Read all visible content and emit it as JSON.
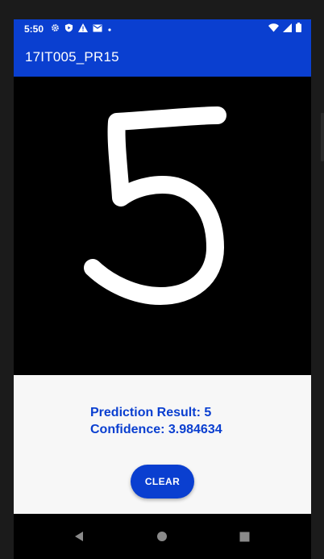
{
  "status_bar": {
    "time": "5:50",
    "left_icons": [
      "gear-icon",
      "play-protect-icon",
      "warning-icon",
      "mail-icon",
      "dot-icon"
    ],
    "right_icons": [
      "wifi-icon",
      "signal-icon",
      "battery-icon"
    ]
  },
  "app_bar": {
    "title": "17IT005_PR15",
    "color": "#0a3fd0"
  },
  "canvas": {
    "background": "#000000",
    "stroke_color": "#ffffff",
    "drawn_digit": "5"
  },
  "result": {
    "prediction_line": "Prediction Result: 5",
    "confidence_line": "Confidence: 3.984634",
    "text_color": "#0a3fd0"
  },
  "clear_button": {
    "label": "CLEAR"
  },
  "nav_bar": {
    "buttons": [
      "back-icon",
      "home-icon",
      "recents-icon"
    ]
  }
}
